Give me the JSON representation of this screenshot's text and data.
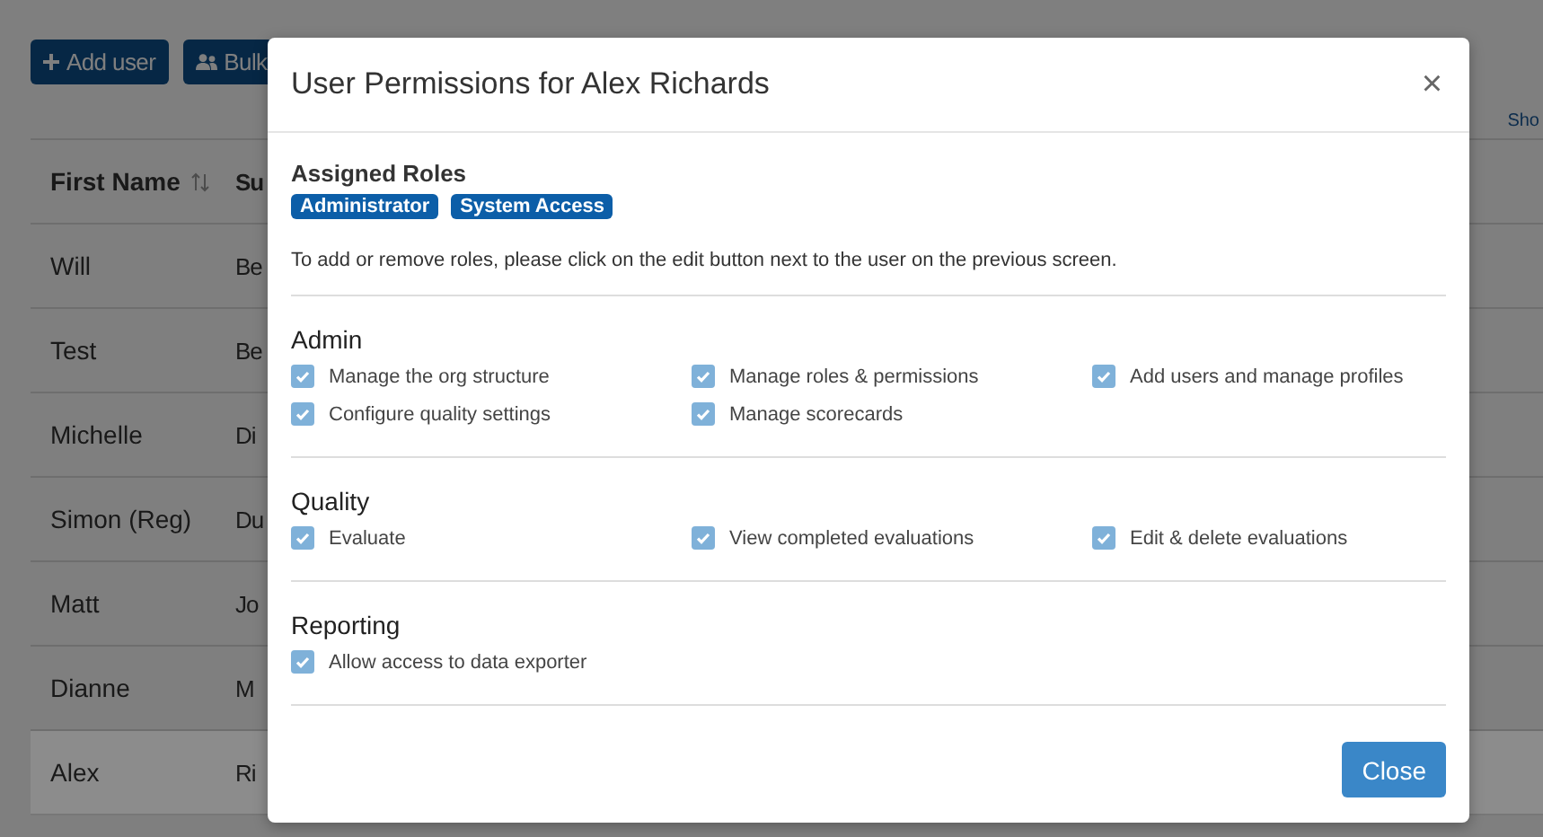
{
  "page": {
    "toolbar_buttons": [
      {
        "kind": "add",
        "label": "Add user"
      },
      {
        "kind": "bulk",
        "label": "Bulk"
      }
    ],
    "side_link": "Sho",
    "table": {
      "columns": [
        "First Name",
        "Su"
      ],
      "rows": [
        {
          "first_name": "Will",
          "column_2": "Be",
          "selected": false
        },
        {
          "first_name": "Test",
          "column_2": "Be",
          "selected": false
        },
        {
          "first_name": "Michelle",
          "column_2": "Di",
          "selected": false
        },
        {
          "first_name": "Simon (Reg)",
          "column_2": "Du",
          "selected": false
        },
        {
          "first_name": "Matt",
          "column_2": "Jo",
          "selected": false
        },
        {
          "first_name": "Dianne",
          "column_2": "M",
          "selected": false
        },
        {
          "first_name": "Alex",
          "column_2": "Ri",
          "selected": true
        }
      ]
    }
  },
  "dialog": {
    "title": "User Permissions for Alex Richards",
    "close_symbol": "×",
    "assigned_roles": {
      "heading": "Assigned Roles",
      "roles": [
        "Administrator",
        "System Access"
      ],
      "note": "To add or remove roles, please click on the edit button next to the user on the previous screen."
    },
    "sections": [
      {
        "heading": "Admin",
        "permissions": [
          {
            "label": "Manage the org structure",
            "checked": true
          },
          {
            "label": "Manage roles & permissions",
            "checked": true
          },
          {
            "label": "Add users and manage profiles",
            "checked": true
          },
          {
            "label": "Configure quality settings",
            "checked": true
          },
          {
            "label": "Manage scorecards",
            "checked": true
          }
        ]
      },
      {
        "heading": "Quality",
        "permissions": [
          {
            "label": "Evaluate",
            "checked": true
          },
          {
            "label": "View completed evaluations",
            "checked": true
          },
          {
            "label": "Edit & delete evaluations",
            "checked": true
          }
        ]
      },
      {
        "heading": "Reporting",
        "permissions": [
          {
            "label": "Allow access to data exporter",
            "checked": true
          }
        ]
      }
    ],
    "buttons": [
      {
        "label": "Close"
      }
    ]
  }
}
